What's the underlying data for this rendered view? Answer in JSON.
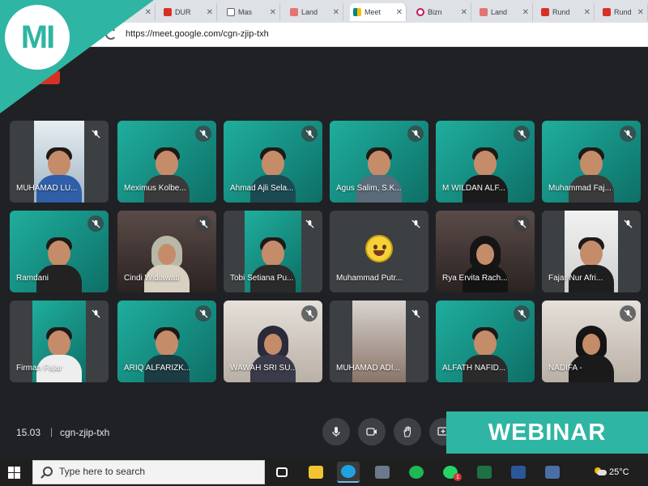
{
  "browser": {
    "tabs": [
      {
        "title": "",
        "icon": "blank-tab-icon",
        "color": "#ffffff"
      },
      {
        "title": "DUR",
        "icon": "pdf-icon",
        "color": "#d93025"
      },
      {
        "title": "Mas",
        "icon": "document-icon",
        "color": "#5f6368"
      },
      {
        "title": "Land",
        "icon": "landing-icon",
        "color": "#e57373"
      },
      {
        "title": "Meet",
        "icon": "google-meet-icon",
        "color": "#00897b"
      },
      {
        "title": "Bizn",
        "icon": "bizn-icon",
        "color": "#c2185b"
      },
      {
        "title": "Land",
        "icon": "landing-icon",
        "color": "#e57373"
      },
      {
        "title": "Rund",
        "icon": "pdf-icon",
        "color": "#d93025"
      },
      {
        "title": "Rund",
        "icon": "pdf-icon",
        "color": "#d93025"
      }
    ],
    "url": "https://meet.google.com/cgn-zjip-txh"
  },
  "participants": [
    {
      "name": "MUHAMAD LU...",
      "bg": "window"
    },
    {
      "name": "Meximus Kolbe...",
      "bg": "teal"
    },
    {
      "name": "Ahmad Ajli Sela...",
      "bg": "teal"
    },
    {
      "name": "Agus Salim, S.K...",
      "bg": "teal"
    },
    {
      "name": "M WILDAN ALF...",
      "bg": "teal"
    },
    {
      "name": "Muhammad Faj...",
      "bg": "teal"
    },
    {
      "name": "Ramdani",
      "bg": "teal"
    },
    {
      "name": "Cindi Widiawati",
      "bg": "dark"
    },
    {
      "name": "Tobi Setiana Pu...",
      "bg": "window"
    },
    {
      "name": "Muhammad Putr...",
      "bg": "emoji"
    },
    {
      "name": "Rya Ervita Rach...",
      "bg": "dark"
    },
    {
      "name": "Fajar Nur Afri...",
      "bg": "window"
    },
    {
      "name": "Firman Fajar",
      "bg": "window"
    },
    {
      "name": "ARIQ ALFARIZK...",
      "bg": "teal"
    },
    {
      "name": "WAWAH SRI SU...",
      "bg": "light"
    },
    {
      "name": "MUHAMAD ADI...",
      "bg": "room"
    },
    {
      "name": "ALFATH NAFID...",
      "bg": "teal"
    },
    {
      "name": "NADIFA -",
      "bg": "light"
    }
  ],
  "meeting": {
    "time": "15.03",
    "separator": "|",
    "code": "cgn-zjip-txh",
    "controls": [
      "microphone-icon",
      "camera-icon",
      "raise-hand-icon",
      "present-screen-icon"
    ]
  },
  "taskbar": {
    "search_placeholder": "Type here to search",
    "apps": [
      {
        "icon": "task-view-icon",
        "color": "#ffffff"
      },
      {
        "icon": "file-explorer-icon",
        "color": "#f4c430"
      },
      {
        "icon": "edge-browser-icon",
        "color": "#1fa3e0"
      },
      {
        "icon": "camera-app-icon",
        "color": "#6a7a8a"
      },
      {
        "icon": "spotify-icon",
        "color": "#1db954"
      },
      {
        "icon": "whatsapp-icon",
        "color": "#25d366",
        "badge": "1"
      },
      {
        "icon": "excel-icon",
        "color": "#1e7145"
      },
      {
        "icon": "word-icon",
        "color": "#2b579a"
      },
      {
        "icon": "store-icon",
        "color": "#4a6fa5"
      }
    ],
    "weather_icon": "partly-cloudy-icon",
    "temperature": "25°C"
  },
  "overlay": {
    "logo_text": "MI",
    "banner_text": "WEBINAR",
    "accent": "#2fb5a3"
  }
}
